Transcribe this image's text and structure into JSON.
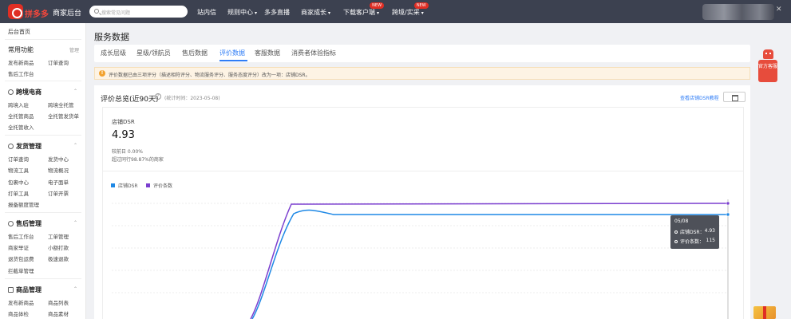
{
  "topbar": {
    "brand": "拼多多",
    "brand_sub": "商家后台",
    "search_placeholder": "搜索常见问题",
    "nav": [
      {
        "label": "站内信",
        "new": false
      },
      {
        "label": "规则中心",
        "new": false
      },
      {
        "label": "多多直播",
        "new": false
      },
      {
        "label": "商家成长",
        "new": false
      },
      {
        "label": "下载客户端",
        "new": true
      },
      {
        "label": "跨境/实采",
        "new": true
      }
    ],
    "new_label": "NEW"
  },
  "sidebar": {
    "home": "后台首页",
    "common": {
      "title": "常用功能",
      "manage": "管理",
      "links": [
        "发布新商品",
        "订单查询",
        "售后工作台"
      ]
    },
    "cross_border": {
      "title": "跨境电商",
      "links": [
        "跨境入驻",
        "跨境全托管",
        "全托管商品",
        "全托管发货单",
        "全托管收入"
      ]
    },
    "shipping": {
      "title": "发货管理",
      "links": [
        "订单查询",
        "发货中心",
        "物流工具",
        "物流概况",
        "包裹中心",
        "电子面单",
        "打单工具",
        "订单开票",
        "报备额度管理"
      ]
    },
    "aftersales": {
      "title": "售后管理",
      "links": [
        "售后工作台",
        "工单管理",
        "商家举证",
        "小额打款",
        "退货包运费",
        "极速退款",
        "拦截单管理"
      ]
    },
    "goods": {
      "title": "商品管理",
      "links": [
        "发布新商品",
        "商品列表",
        "商品体检",
        "商品素材"
      ]
    }
  },
  "main": {
    "page_title": "服务数据",
    "tabs": [
      "成长层级",
      "星级/领航员",
      "售后数据",
      "评价数据",
      "客服数据",
      "消费者体验指标"
    ],
    "active_tab": 3,
    "notice": "评价数据已由三项评分（描述相符评分、物流服务评分、服务态度评分）改为一项：店铺DSR。",
    "card": {
      "title": "评价总览(近90天)",
      "stat_time": "(统计时间：2023-05-08)",
      "tutorial": "查看店铺DSR教程",
      "dsr_label": "店铺DSR",
      "dsr_value": "4.93",
      "cmp_prev": "较前日  0.00%",
      "cmp_peer": "超过同行98.87%的商家",
      "legend": [
        {
          "name": "店铺DSR",
          "color": "#1e88e5"
        },
        {
          "name": "评价条数",
          "color": "#7b3fcf"
        }
      ]
    },
    "tooltip": {
      "date": "05/08",
      "rows": [
        {
          "label": "店铺DSR：",
          "value": "4.93"
        },
        {
          "label": "评价条数：",
          "value": "115"
        }
      ]
    }
  },
  "side_widget": {
    "label": "官方客服"
  }
}
